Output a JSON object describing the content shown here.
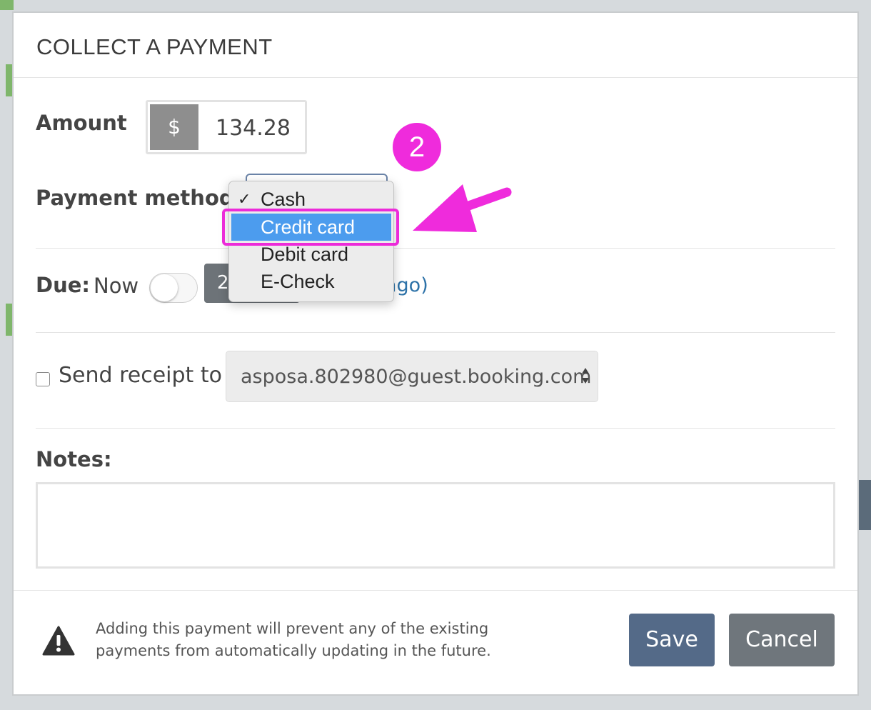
{
  "modal": {
    "title": "COLLECT A PAYMENT"
  },
  "amount": {
    "label": "Amount",
    "currency_symbol": "$",
    "value": "134.28"
  },
  "payment_method": {
    "label": "Payment method",
    "options": [
      {
        "label": "Cash",
        "checked": true
      },
      {
        "label": "Credit card",
        "highlighted": true
      },
      {
        "label": "Debit card"
      },
      {
        "label": "E-Check"
      }
    ]
  },
  "due": {
    "label": "Due:",
    "now_label": "Now",
    "date_partial": "2",
    "relative_partial": "ago)"
  },
  "receipt": {
    "label": "Send receipt to",
    "email": "asposa.802980@guest.booking.com"
  },
  "notes": {
    "label": "Notes:"
  },
  "footer": {
    "warning": "Adding this payment will prevent any of the existing payments from automatically updating in the future.",
    "save_label": "Save",
    "cancel_label": "Cancel"
  },
  "annotation": {
    "step_number": "2"
  },
  "colors": {
    "primary_button": "#546a88",
    "secondary_button": "#6f767c",
    "annotation": "#ef2bdc",
    "menu_highlight": "#4c9cee",
    "link": "#2d72a8"
  },
  "icons": {
    "warning": "warning-icon",
    "checkmark": "checkmark-icon",
    "select_arrows": "select-arrows-icon",
    "annotation_arrow": "arrow-icon"
  }
}
